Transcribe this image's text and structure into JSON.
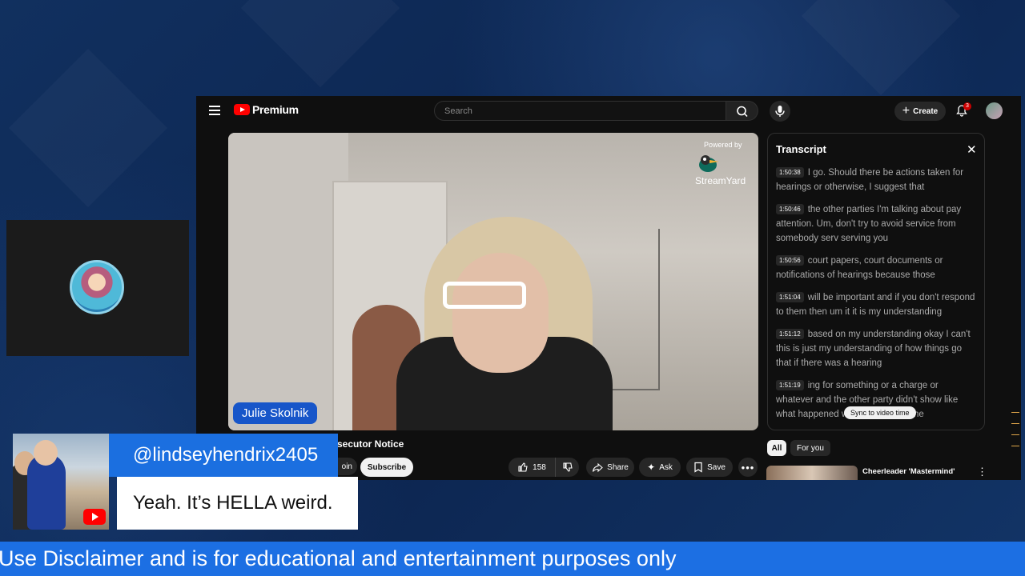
{
  "header": {
    "logo_text": "Premium",
    "search_placeholder": "Search",
    "create_label": "Create",
    "notification_count": "3"
  },
  "video": {
    "powered_by": "Powered by",
    "brand": "StreamYard",
    "name_tag": "Julie Skolnik",
    "title_partial": "secutor Notice",
    "join_label": "oin",
    "subscribe_label": "Subscribe",
    "likes": "158",
    "share_label": "Share",
    "ask_label": "Ask",
    "save_label": "Save"
  },
  "transcript": {
    "title": "Transcript",
    "segments": [
      {
        "time": "1:50:38",
        "text": "I go. Should there be actions taken for hearings or otherwise, I suggest that"
      },
      {
        "time": "1:50:46",
        "text": "the other parties I'm talking about pay attention. Um, don't try to avoid service from somebody serv serving you"
      },
      {
        "time": "1:50:56",
        "text": "court papers, court documents or notifications of hearings because those"
      },
      {
        "time": "1:51:04",
        "text": "will be important and if you don't respond to them then um it it is my understanding"
      },
      {
        "time": "1:51:12",
        "text": "based on my understanding okay I can't this is just my understanding of how things go that if there was a hearing"
      },
      {
        "time": "1:51:19",
        "text": "ing for something or a charge or whatever and the other party didn't show like what happened with Granny that the"
      }
    ],
    "sync_label": "Sync to video time"
  },
  "recommendations": {
    "chips": [
      "All",
      "For you"
    ],
    "first_title": "Cheerleader 'Mastermind'"
  },
  "chat": {
    "username": "@lindseyhendrix2405",
    "message": "Yeah. It’s HELLA weird."
  },
  "ticker": {
    "text": "Use Disclaimer and is for educational and entertainment purposes only"
  }
}
